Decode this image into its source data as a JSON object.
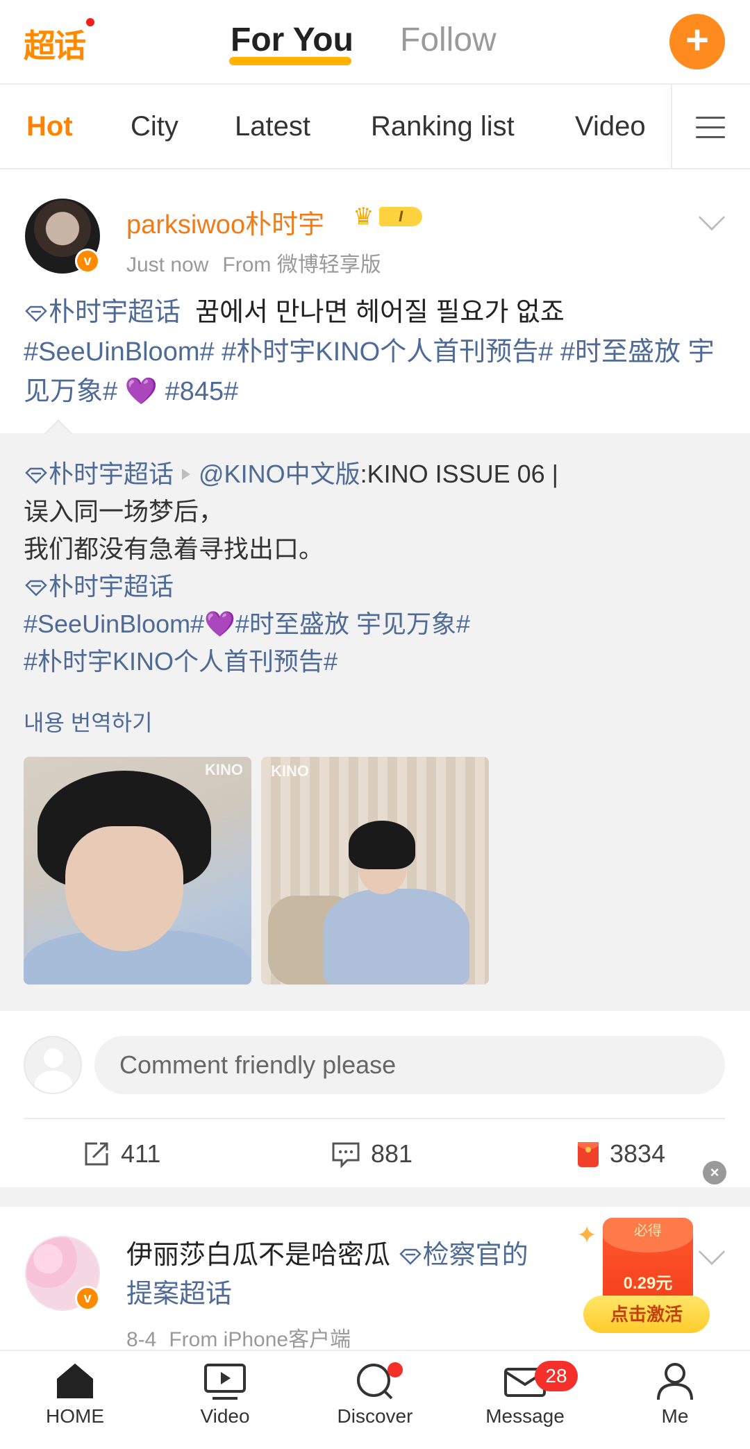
{
  "header": {
    "logo_text": "超话",
    "tab_for_you": "For You",
    "tab_follow": "Follow",
    "accent": "#ff8a1e"
  },
  "subtabs": {
    "items": [
      "Hot",
      "City",
      "Latest",
      "Ranking list",
      "Video"
    ],
    "active": "Hot"
  },
  "post": {
    "author": "parksiwoo朴时宇",
    "level": "I",
    "time": "Just now",
    "source": "From 微博轻享版",
    "super_topic": "朴时宇超话",
    "korean_text": "꿈에서 만나면 헤어질 필요가 없죠",
    "tag1": "#SeeUinBloom#",
    "tag2": "#朴时宇KINO个人首刊预告#",
    "tag3": "#时至盛放 宇见万象#",
    "emoji": "💜",
    "tag4": "#845#"
  },
  "repost": {
    "super_topic": "朴时宇超话",
    "mention": "@KINO中文版",
    "issue": ":KINO ISSUE 06 |",
    "line2": "误入同一场梦后，",
    "line3": "我们都没有急着寻找出口。",
    "super_topic2": "朴时宇超话",
    "tag_a": "#SeeUinBloom#",
    "emoji": "💜",
    "tag_b": "#时至盛放 宇见万象#",
    "tag_c": "#朴时宇KINO个人首刊预告#",
    "translate": "내용 번역하기",
    "watermark1": "KINO",
    "watermark2": "KINO"
  },
  "comment": {
    "placeholder": "Comment friendly please"
  },
  "actions": {
    "reposts": "411",
    "comments": "881",
    "likes": "3834"
  },
  "post2": {
    "title_a": "伊丽莎白瓜不是哈密瓜",
    "topic": "检察官的提案超话",
    "date": "8-4",
    "source": "From iPhone客户端"
  },
  "red_packet": {
    "must_get": "必得",
    "amount": "0.29元",
    "activate": "点击激活"
  },
  "bottom_nav": {
    "home": "HOME",
    "video": "Video",
    "discover": "Discover",
    "message": "Message",
    "message_badge": "28",
    "me": "Me"
  }
}
